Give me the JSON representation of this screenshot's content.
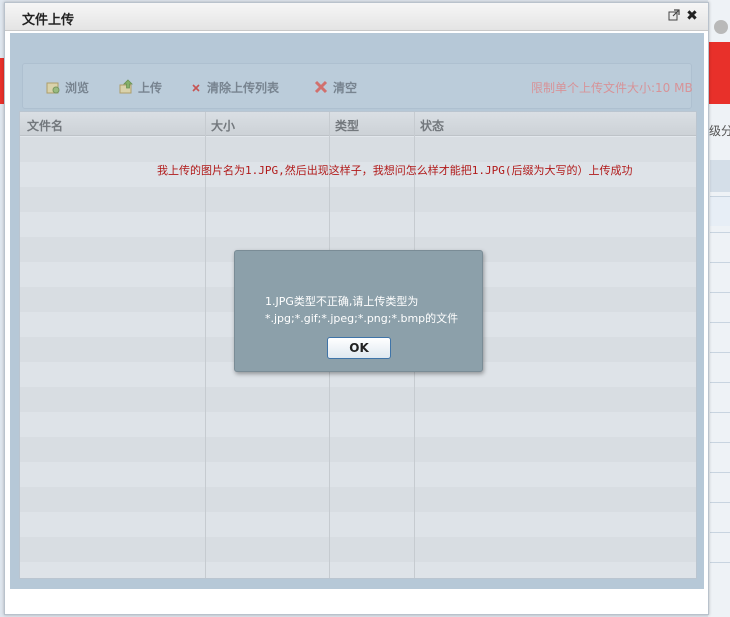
{
  "window": {
    "title": "文件上传",
    "popout_icon": "popout-icon",
    "close_icon": "close-icon"
  },
  "toolbar": {
    "browse_label": "浏览",
    "upload_label": "上传",
    "clear_list_label": "清除上传列表",
    "clear_label": "清空",
    "limit_text": "限制单个上传文件大小:10 MB"
  },
  "table": {
    "columns": [
      "文件名",
      "大小",
      "类型",
      "状态"
    ],
    "rows": []
  },
  "annotation": "我上传的图片名为1.JPG,然后出现这样子，我想问怎么样才能把1.JPG(后缀为大写的）上传成功",
  "dialog": {
    "message_line1": "1.JPG类型不正确,请上传类型为",
    "message_line2": "*.jpg;*.gif;*.jpeg;*.png;*.bmp的文件",
    "ok_label": "OK"
  },
  "background": {
    "right_tab_text": "级分"
  },
  "colors": {
    "limit_text": "#f08b8b",
    "annotation": "#b11a1a",
    "dialog_bg": "#8ca0aa",
    "content_bg": "#c3d4e2",
    "brand_red": "#e8302a"
  }
}
